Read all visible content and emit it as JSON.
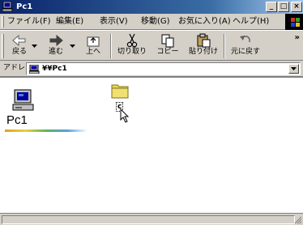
{
  "window": {
    "title": "Pc1",
    "minimize_glyph": "_",
    "maximize_glyph": "□",
    "close_glyph": "×"
  },
  "menu": {
    "items": [
      "ファイル(F)",
      "編集(E)",
      "表示(V)",
      "移動(G)",
      "お気に入り(A)",
      "ヘルプ(H)"
    ]
  },
  "toolbar": {
    "buttons": [
      "戻る",
      "進む",
      "上へ",
      "切り取り",
      "コピー",
      "貼り付け",
      "元に戻す"
    ],
    "overflow": "»"
  },
  "address": {
    "label": "アドレス(D)",
    "value": "¥¥Pc1"
  },
  "content": {
    "location_title": "Pc1",
    "items": [
      {
        "label": "c",
        "icon": "folder-icon"
      }
    ]
  },
  "colors": {
    "title_bar": "#0a246a",
    "chrome": "#d4d0c8",
    "folder": "#e8d84a"
  }
}
